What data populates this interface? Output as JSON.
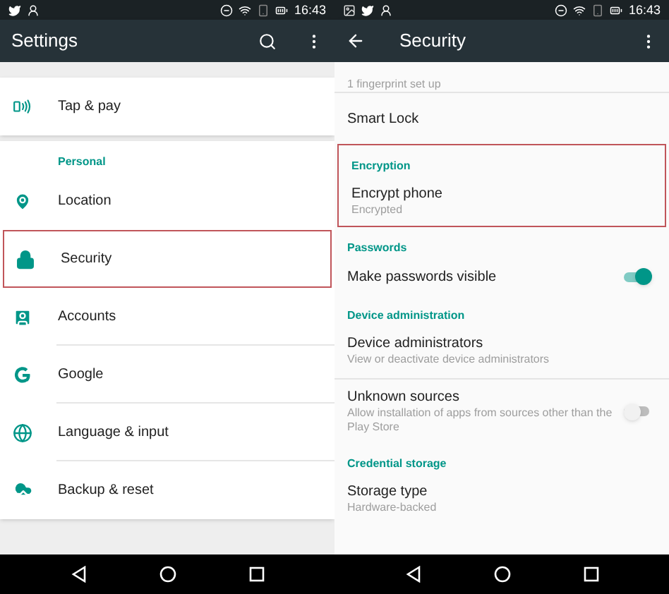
{
  "screens": [
    {
      "time": "16:43",
      "title": "Settings",
      "back_button": false,
      "search_button": true,
      "more_button": true,
      "kind": "cards",
      "sections": [
        {
          "items": [
            {
              "kind": "row",
              "title": "Tap & pay",
              "highlighted": false,
              "divider": false
            }
          ]
        },
        {
          "items": [
            {
              "kind": "header",
              "title": "Personal",
              "highlighted": false
            },
            {
              "kind": "row",
              "title": "Location",
              "highlighted": false,
              "divider": false
            },
            {
              "kind": "row",
              "title": "Security",
              "highlighted": true,
              "divider": false
            },
            {
              "kind": "row",
              "title": "Accounts",
              "highlighted": false,
              "divider": true
            },
            {
              "kind": "row",
              "title": "Google",
              "highlighted": false,
              "divider": true
            },
            {
              "kind": "row",
              "title": "Language & input",
              "highlighted": false,
              "divider": true
            },
            {
              "kind": "row",
              "title": "Backup & reset",
              "highlighted": false,
              "divider": false
            }
          ]
        }
      ]
    },
    {
      "time": "16:43",
      "title": "Security",
      "back_button": true,
      "search_button": false,
      "more_button": true,
      "kind": "plain",
      "sections": [
        {
          "items": [
            {
              "kind": "partial",
              "subtitle": "1 fingerprint set up",
              "highlighted": false
            }
          ]
        },
        {
          "items": [
            {
              "kind": "row",
              "title": "Smart Lock",
              "highlighted": false,
              "divider": false
            },
            {
              "kind": "header",
              "title": "Encryption",
              "highlighted": true
            },
            {
              "kind": "row",
              "title": "Encrypt phone",
              "subtitle": "Encrypted",
              "highlighted": true,
              "divider": false
            },
            {
              "kind": "header",
              "title": "Passwords",
              "highlighted": false
            },
            {
              "kind": "toggle",
              "title": "Make passwords visible",
              "on": true,
              "highlighted": false
            },
            {
              "kind": "header",
              "title": "Device administration",
              "highlighted": false
            },
            {
              "kind": "row",
              "title": "Device administrators",
              "subtitle": "View or deactivate device administrators",
              "highlighted": false,
              "divider": false
            }
          ]
        },
        {
          "items": [
            {
              "kind": "toggle",
              "title": "Unknown sources",
              "subtitle": "Allow installation of apps from sources other than the Play Store",
              "on": false,
              "highlighted": false
            },
            {
              "kind": "header",
              "title": "Credential storage",
              "highlighted": false
            },
            {
              "kind": "row",
              "title": "Storage type",
              "subtitle": "Hardware-backed",
              "highlighted": false,
              "divider": false
            }
          ]
        }
      ]
    }
  ]
}
